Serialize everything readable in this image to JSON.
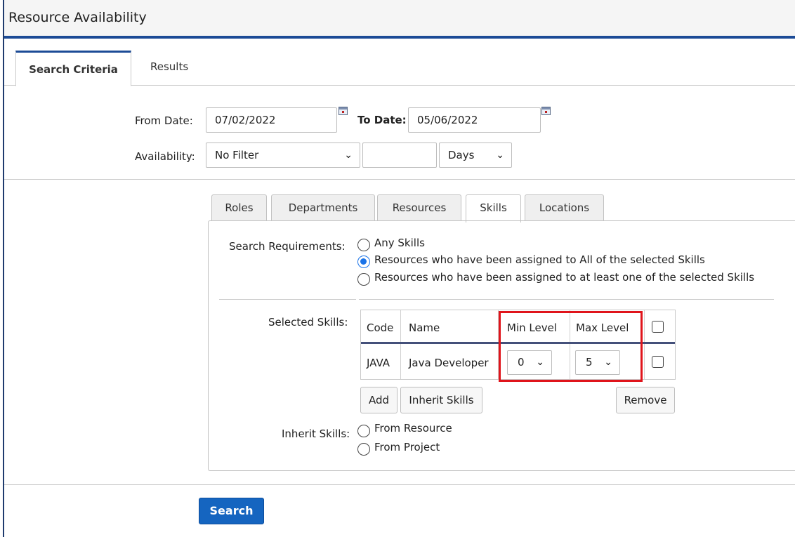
{
  "window": {
    "title": "Resource Availability"
  },
  "tabs": {
    "search_criteria": "Search Criteria",
    "results": "Results"
  },
  "criteria": {
    "from_date_label": "From Date:",
    "from_date_value": "07/02/2022",
    "to_date_label": "To Date:",
    "to_date_value": "05/06/2022",
    "availability_label": "Availability:",
    "availability_value": "No Filter",
    "availability_amount": "",
    "unit_value": "Days"
  },
  "subtabs": [
    "Roles",
    "Departments",
    "Resources",
    "Skills",
    "Locations"
  ],
  "skills_panel": {
    "search_requirements_label": "Search Requirements:",
    "options": [
      "Any Skills",
      "Resources who have been assigned to All of the selected Skills",
      "Resources who have been assigned to at least one of the selected Skills"
    ],
    "selected_option": 1,
    "selected_skills_label": "Selected Skills:",
    "table": {
      "headers": {
        "code": "Code",
        "name": "Name",
        "min_level": "Min Level",
        "max_level": "Max Level"
      },
      "rows": [
        {
          "code": "JAVA",
          "name": "Java Developer",
          "min_level": "0",
          "max_level": "5"
        }
      ]
    },
    "buttons": {
      "add": "Add",
      "inherit_skills": "Inherit Skills",
      "remove": "Remove"
    },
    "inherit_skills_label": "Inherit Skills:",
    "inherit_options": [
      "From Resource",
      "From Project"
    ]
  },
  "search_button": "Search",
  "colors": {
    "accent": "#1c4b96",
    "primary_button": "#1565c0",
    "highlight": "#e0141b",
    "radio_checked": "#1a73e8"
  }
}
